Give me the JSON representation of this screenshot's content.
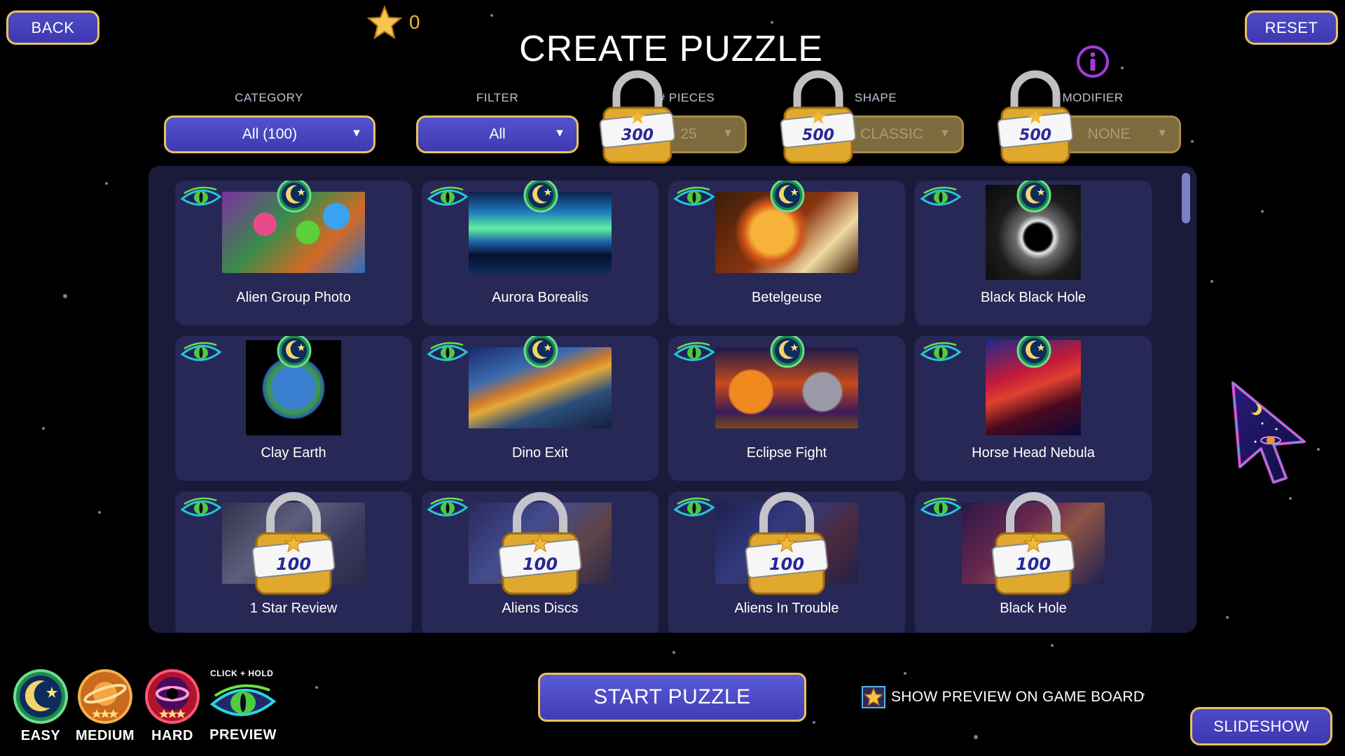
{
  "header": {
    "back_label": "BACK",
    "reset_label": "RESET",
    "title": "CREATE PUZZLE",
    "star_count": "0"
  },
  "selectors": {
    "category": {
      "label": "CATEGORY",
      "value": "All (100)"
    },
    "filter": {
      "label": "FILTER",
      "value": "All"
    },
    "pieces": {
      "label": "# PIECES",
      "value": "25",
      "lock_cost": "300"
    },
    "shape": {
      "label": "SHAPE",
      "value": "CLASSIC",
      "lock_cost": "500"
    },
    "modifier": {
      "label": "MODIFIER",
      "value": "NONE",
      "lock_cost": "500"
    }
  },
  "puzzles": [
    {
      "title": "Alien Group Photo",
      "locked": false,
      "difficulty": "easy"
    },
    {
      "title": "Aurora Borealis",
      "locked": false,
      "difficulty": "easy"
    },
    {
      "title": "Betelgeuse",
      "locked": false,
      "difficulty": "easy"
    },
    {
      "title": "Black Black Hole",
      "locked": false,
      "difficulty": "easy"
    },
    {
      "title": "Clay Earth",
      "locked": false,
      "difficulty": "easy"
    },
    {
      "title": "Dino Exit",
      "locked": false,
      "difficulty": "easy"
    },
    {
      "title": "Eclipse Fight",
      "locked": false,
      "difficulty": "easy"
    },
    {
      "title": "Horse Head Nebula",
      "locked": false,
      "difficulty": "easy"
    },
    {
      "title": "1 Star Review",
      "locked": true,
      "lock_cost": "100"
    },
    {
      "title": "Aliens Discs",
      "locked": true,
      "lock_cost": "100"
    },
    {
      "title": "Aliens In Trouble",
      "locked": true,
      "lock_cost": "100"
    },
    {
      "title": "Black Hole",
      "locked": true,
      "lock_cost": "100"
    }
  ],
  "footer": {
    "start_label": "START PUZZLE",
    "show_preview_label": "SHOW PREVIEW ON GAME BOARD",
    "slideshow_label": "SLIDESHOW",
    "legend": {
      "easy": "EASY",
      "medium": "MEDIUM",
      "hard": "HARD",
      "preview": "PREVIEW",
      "click_hold": "CLICK + HOLD"
    }
  },
  "colors": {
    "accent_gold": "#e9c35a",
    "button_blue": "#4e4bc6",
    "panel": "#1a1a3a",
    "card": "#282856",
    "star": "#f2b734"
  }
}
